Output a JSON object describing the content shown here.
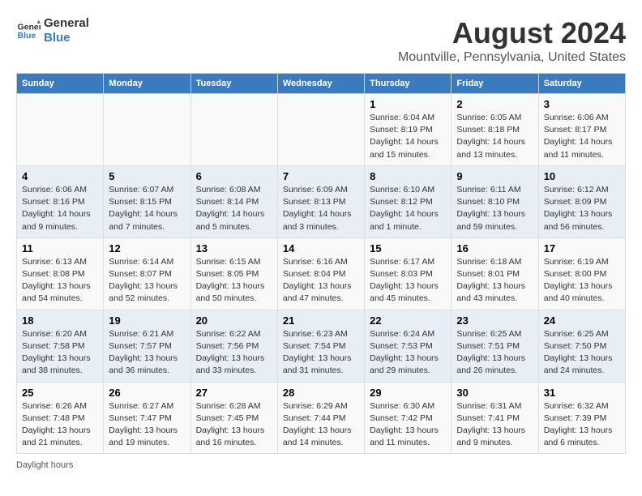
{
  "logo": {
    "general": "General",
    "blue": "Blue"
  },
  "title": "August 2024",
  "subtitle": "Mountville, Pennsylvania, United States",
  "days_of_week": [
    "Sunday",
    "Monday",
    "Tuesday",
    "Wednesday",
    "Thursday",
    "Friday",
    "Saturday"
  ],
  "footer": "Daylight hours",
  "weeks": [
    [
      {
        "day": "",
        "content": ""
      },
      {
        "day": "",
        "content": ""
      },
      {
        "day": "",
        "content": ""
      },
      {
        "day": "",
        "content": ""
      },
      {
        "day": "1",
        "content": "Sunrise: 6:04 AM\nSunset: 8:19 PM\nDaylight: 14 hours and 15 minutes."
      },
      {
        "day": "2",
        "content": "Sunrise: 6:05 AM\nSunset: 8:18 PM\nDaylight: 14 hours and 13 minutes."
      },
      {
        "day": "3",
        "content": "Sunrise: 6:06 AM\nSunset: 8:17 PM\nDaylight: 14 hours and 11 minutes."
      }
    ],
    [
      {
        "day": "4",
        "content": "Sunrise: 6:06 AM\nSunset: 8:16 PM\nDaylight: 14 hours and 9 minutes."
      },
      {
        "day": "5",
        "content": "Sunrise: 6:07 AM\nSunset: 8:15 PM\nDaylight: 14 hours and 7 minutes."
      },
      {
        "day": "6",
        "content": "Sunrise: 6:08 AM\nSunset: 8:14 PM\nDaylight: 14 hours and 5 minutes."
      },
      {
        "day": "7",
        "content": "Sunrise: 6:09 AM\nSunset: 8:13 PM\nDaylight: 14 hours and 3 minutes."
      },
      {
        "day": "8",
        "content": "Sunrise: 6:10 AM\nSunset: 8:12 PM\nDaylight: 14 hours and 1 minute."
      },
      {
        "day": "9",
        "content": "Sunrise: 6:11 AM\nSunset: 8:10 PM\nDaylight: 13 hours and 59 minutes."
      },
      {
        "day": "10",
        "content": "Sunrise: 6:12 AM\nSunset: 8:09 PM\nDaylight: 13 hours and 56 minutes."
      }
    ],
    [
      {
        "day": "11",
        "content": "Sunrise: 6:13 AM\nSunset: 8:08 PM\nDaylight: 13 hours and 54 minutes."
      },
      {
        "day": "12",
        "content": "Sunrise: 6:14 AM\nSunset: 8:07 PM\nDaylight: 13 hours and 52 minutes."
      },
      {
        "day": "13",
        "content": "Sunrise: 6:15 AM\nSunset: 8:05 PM\nDaylight: 13 hours and 50 minutes."
      },
      {
        "day": "14",
        "content": "Sunrise: 6:16 AM\nSunset: 8:04 PM\nDaylight: 13 hours and 47 minutes."
      },
      {
        "day": "15",
        "content": "Sunrise: 6:17 AM\nSunset: 8:03 PM\nDaylight: 13 hours and 45 minutes."
      },
      {
        "day": "16",
        "content": "Sunrise: 6:18 AM\nSunset: 8:01 PM\nDaylight: 13 hours and 43 minutes."
      },
      {
        "day": "17",
        "content": "Sunrise: 6:19 AM\nSunset: 8:00 PM\nDaylight: 13 hours and 40 minutes."
      }
    ],
    [
      {
        "day": "18",
        "content": "Sunrise: 6:20 AM\nSunset: 7:58 PM\nDaylight: 13 hours and 38 minutes."
      },
      {
        "day": "19",
        "content": "Sunrise: 6:21 AM\nSunset: 7:57 PM\nDaylight: 13 hours and 36 minutes."
      },
      {
        "day": "20",
        "content": "Sunrise: 6:22 AM\nSunset: 7:56 PM\nDaylight: 13 hours and 33 minutes."
      },
      {
        "day": "21",
        "content": "Sunrise: 6:23 AM\nSunset: 7:54 PM\nDaylight: 13 hours and 31 minutes."
      },
      {
        "day": "22",
        "content": "Sunrise: 6:24 AM\nSunset: 7:53 PM\nDaylight: 13 hours and 29 minutes."
      },
      {
        "day": "23",
        "content": "Sunrise: 6:25 AM\nSunset: 7:51 PM\nDaylight: 13 hours and 26 minutes."
      },
      {
        "day": "24",
        "content": "Sunrise: 6:25 AM\nSunset: 7:50 PM\nDaylight: 13 hours and 24 minutes."
      }
    ],
    [
      {
        "day": "25",
        "content": "Sunrise: 6:26 AM\nSunset: 7:48 PM\nDaylight: 13 hours and 21 minutes."
      },
      {
        "day": "26",
        "content": "Sunrise: 6:27 AM\nSunset: 7:47 PM\nDaylight: 13 hours and 19 minutes."
      },
      {
        "day": "27",
        "content": "Sunrise: 6:28 AM\nSunset: 7:45 PM\nDaylight: 13 hours and 16 minutes."
      },
      {
        "day": "28",
        "content": "Sunrise: 6:29 AM\nSunset: 7:44 PM\nDaylight: 13 hours and 14 minutes."
      },
      {
        "day": "29",
        "content": "Sunrise: 6:30 AM\nSunset: 7:42 PM\nDaylight: 13 hours and 11 minutes."
      },
      {
        "day": "30",
        "content": "Sunrise: 6:31 AM\nSunset: 7:41 PM\nDaylight: 13 hours and 9 minutes."
      },
      {
        "day": "31",
        "content": "Sunrise: 6:32 AM\nSunset: 7:39 PM\nDaylight: 13 hours and 6 minutes."
      }
    ]
  ]
}
